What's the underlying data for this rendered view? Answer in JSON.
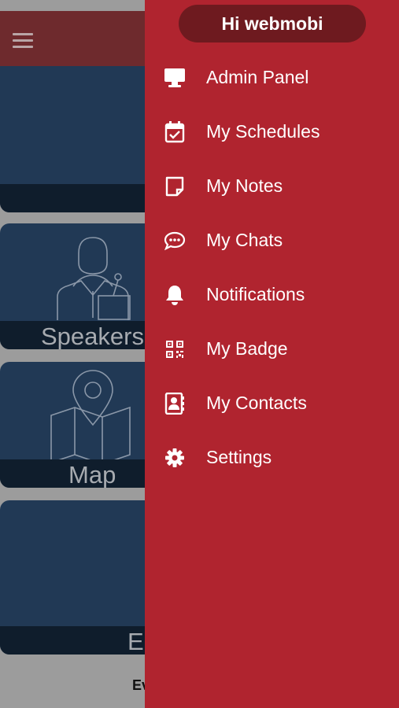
{
  "drawer": {
    "greeting": "Hi webmobi",
    "items": [
      {
        "label": "Admin Panel",
        "icon": "monitor-icon"
      },
      {
        "label": "My Schedules",
        "icon": "calendar-check-icon"
      },
      {
        "label": "My Notes",
        "icon": "note-icon"
      },
      {
        "label": "My Chats",
        "icon": "chat-bubble-icon"
      },
      {
        "label": "Notifications",
        "icon": "bell-icon"
      },
      {
        "label": "My Badge",
        "icon": "qr-code-icon"
      },
      {
        "label": "My Contacts",
        "icon": "contact-book-icon"
      },
      {
        "label": "Settings",
        "icon": "gear-icon"
      }
    ]
  },
  "background": {
    "tiles": [
      {
        "label": ""
      },
      {
        "label": "Speakers"
      },
      {
        "label": "Map"
      },
      {
        "label": "E"
      }
    ],
    "footer_text": "Ev"
  },
  "colors": {
    "drawer_bg": "#b0242f",
    "greeting_bg": "#6e1a1f",
    "header_bg": "#6e2a2d",
    "tile_bg": "#213955"
  }
}
